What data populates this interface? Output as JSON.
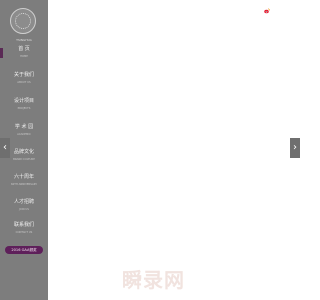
{
  "logo": {
    "icon": "university-seal-logo",
    "text": "TSINGHUA"
  },
  "sidebar": {
    "items": [
      {
        "label": "首 页",
        "sub": "HOME"
      },
      {
        "label": "关于我们",
        "sub": "ABOUT US"
      },
      {
        "label": "设计项目",
        "sub": "PROJECTS"
      },
      {
        "label": "学 术 园",
        "sub": "ACADEMIC"
      },
      {
        "label": "品牌文化",
        "sub": "BRAND CULTURE"
      },
      {
        "label": "六十周年",
        "sub": "60TH ANNIVERSARY"
      },
      {
        "label": "人才招聘",
        "sub": "JOIN US"
      },
      {
        "label": "联系我们",
        "sub": "CONTACT US"
      }
    ],
    "cta_label": "2016 GAA颁奖"
  },
  "carousel": {
    "prev_glyph": "‹",
    "next_glyph": "›"
  },
  "top_icon": "weibo-icon",
  "watermark": "瞬录网",
  "colors": {
    "sidebar": "#7d7d7d",
    "accent": "#5e1f5a",
    "background": "#ffffff"
  }
}
